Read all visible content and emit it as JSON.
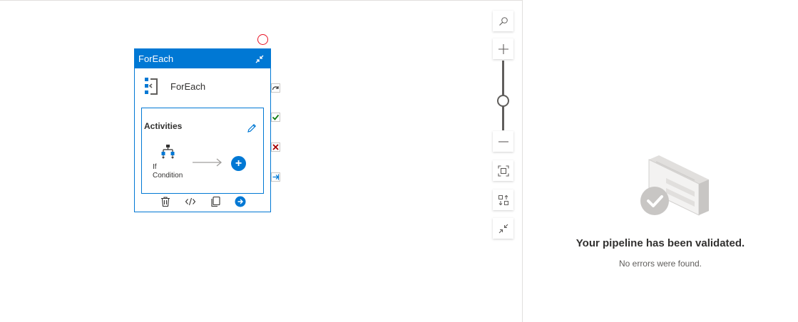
{
  "activity": {
    "header_title": "ForEach",
    "type_label": "ForEach",
    "activities_title": "Activities",
    "child_activity_label": "If\nCondition"
  },
  "validation": {
    "title": "Your pipeline has been validated.",
    "subtitle": "No errors were found."
  },
  "colors": {
    "accent": "#0078d4",
    "success": "#107c10",
    "failure": "#a80000",
    "breakpoint": "#e81123"
  },
  "icons": [
    "foreach-icon",
    "collapse-icon",
    "edit-icon",
    "if-condition-icon",
    "add-icon",
    "delete-icon",
    "code-icon",
    "copy-icon",
    "navigate-icon",
    "skip-icon",
    "success-icon",
    "failure-icon",
    "completion-icon",
    "search-icon",
    "zoom-in-icon",
    "zoom-out-icon",
    "fit-to-screen-icon",
    "auto-align-icon",
    "collapse-all-icon"
  ]
}
